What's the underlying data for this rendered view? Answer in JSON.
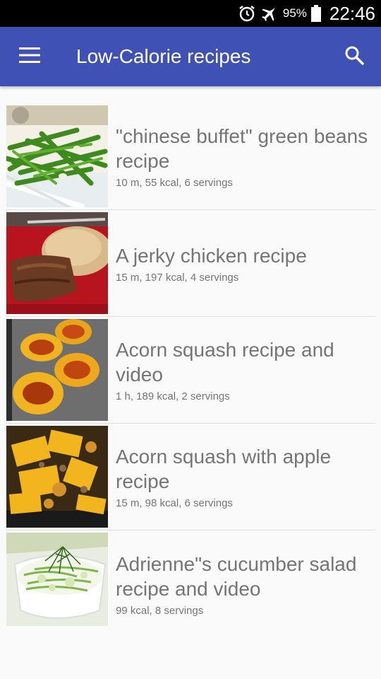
{
  "status_bar": {
    "battery": "95%",
    "time": "22:46"
  },
  "app_bar": {
    "title": "Low-Calorie recipes",
    "menu_icon": "menu-icon",
    "search_icon": "search-icon"
  },
  "recipes": [
    {
      "title": "\"chinese buffet\" green beans recipe",
      "meta": "10 m, 55 kcal, 6 servings",
      "image": "green-beans-photo"
    },
    {
      "title": "A jerky chicken recipe",
      "meta": "15 m, 197 kcal, 4 servings",
      "image": "jerky-chicken-photo"
    },
    {
      "title": "Acorn squash recipe and video",
      "meta": "1 h, 189 kcal, 2 servings",
      "image": "acorn-squash-photo"
    },
    {
      "title": "Acorn squash with apple recipe",
      "meta": "15 m, 98 kcal, 6 servings",
      "image": "squash-apple-photo"
    },
    {
      "title": "Adrienne\"s cucumber salad recipe and video",
      "meta": "99 kcal, 8 servings",
      "image": "cucumber-salad-photo"
    }
  ]
}
